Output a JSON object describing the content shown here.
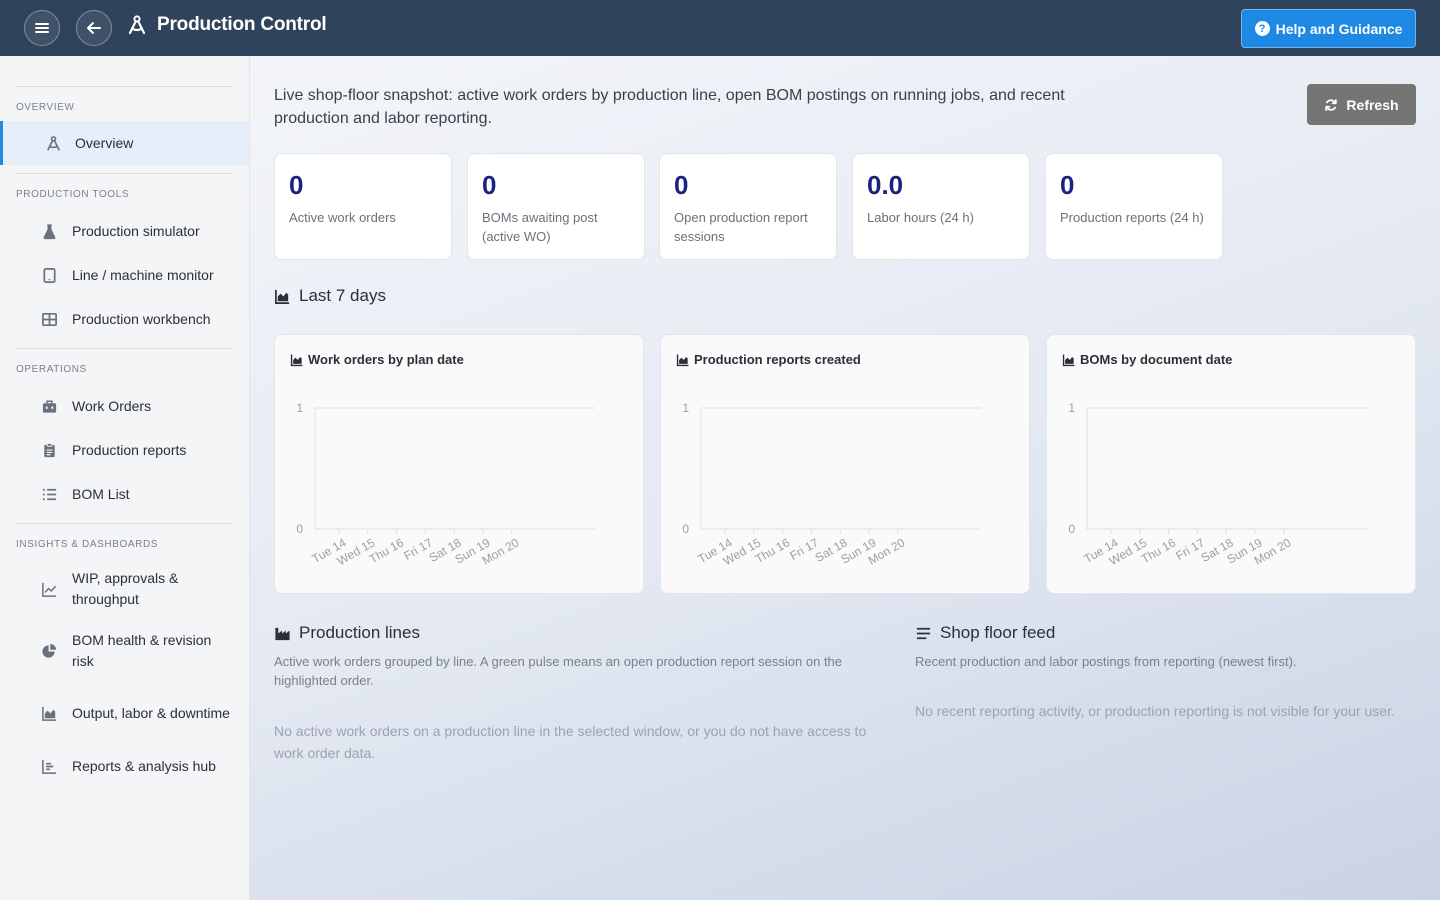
{
  "header": {
    "title": "Production Control",
    "help_label": "Help and Guidance",
    "menu_icon": "hamburger-icon",
    "back_icon": "back-arrow-icon"
  },
  "sidebar": {
    "sections": {
      "overview": "OVERVIEW",
      "tools": "PRODUCTION TOOLS",
      "operations": "OPERATIONS",
      "insights": "INSIGHTS & DASHBOARDS"
    },
    "items": {
      "overview": "Overview",
      "simulator": "Production simulator",
      "monitor": "Line / machine monitor",
      "workbench": "Production workbench",
      "work_orders": "Work Orders",
      "reports": "Production reports",
      "bom_list": "BOM List",
      "wip": "WIP, approvals & throughput",
      "bom_health": "BOM health & revision risk",
      "output": "Output, labor & downtime",
      "hub": "Reports & analysis hub"
    }
  },
  "main": {
    "intro": "Live shop-floor snapshot: active work orders by production line, open BOM postings on running jobs, and recent production and labor reporting.",
    "refresh_label": "Refresh",
    "stats": [
      {
        "value": "0",
        "label": "Active work orders"
      },
      {
        "value": "0",
        "label": "BOMs awaiting post (active WO)"
      },
      {
        "value": "0",
        "label": "Open production report sessions"
      },
      {
        "value": "0.0",
        "label": "Labor hours (24 h)"
      },
      {
        "value": "0",
        "label": "Production reports (24 h)"
      }
    ],
    "last7_title": "Last 7 days",
    "production_lines": {
      "title": "Production lines",
      "subtitle": "Active work orders grouped by line. A green pulse means an open production report session on the highlighted order.",
      "empty": "No active work orders on a production line in the selected window, or you do not have access to work order data."
    },
    "feed": {
      "title": "Shop floor feed",
      "subtitle": "Recent production and labor postings from reporting (newest first).",
      "empty": "No recent reporting activity, or production reporting is not visible for your user."
    }
  },
  "chart_data": [
    {
      "type": "bar",
      "title": "Work orders by plan date",
      "categories": [
        "Tue 14",
        "Wed 15",
        "Thu 16",
        "Fri 17",
        "Sat 18",
        "Sun 19",
        "Mon 20"
      ],
      "values": [
        0,
        0,
        0,
        0,
        0,
        0,
        0
      ],
      "yticks": [
        "0",
        "1"
      ],
      "ylim": [
        0,
        1
      ],
      "grid": true
    },
    {
      "type": "bar",
      "title": "Production reports created",
      "categories": [
        "Tue 14",
        "Wed 15",
        "Thu 16",
        "Fri 17",
        "Sat 18",
        "Sun 19",
        "Mon 20"
      ],
      "values": [
        0,
        0,
        0,
        0,
        0,
        0,
        0
      ],
      "yticks": [
        "0",
        "1"
      ],
      "ylim": [
        0,
        1
      ],
      "grid": true
    },
    {
      "type": "bar",
      "title": "BOMs by document date",
      "categories": [
        "Tue 14",
        "Wed 15",
        "Thu 16",
        "Fri 17",
        "Sat 18",
        "Sun 19",
        "Mon 20"
      ],
      "values": [
        0,
        0,
        0,
        0,
        0,
        0,
        0
      ],
      "yticks": [
        "0",
        "1"
      ],
      "ylim": [
        0,
        1
      ],
      "grid": true
    }
  ]
}
